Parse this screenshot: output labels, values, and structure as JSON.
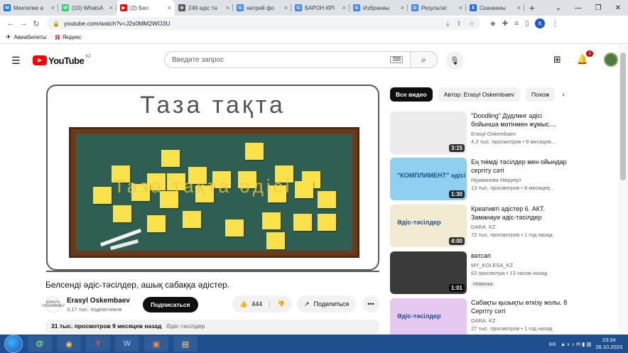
{
  "tabs": [
    {
      "title": "Мектепке а",
      "color": "#1a73e8",
      "glyph": "М"
    },
    {
      "title": "(10) WhatsA",
      "color": "#25d366",
      "glyph": "W"
    },
    {
      "title": "(2) Бел",
      "color": "#ff0000",
      "glyph": "▶",
      "active": true
    },
    {
      "title": "249 әдіс тә",
      "color": "#555555",
      "glyph": "⊕"
    },
    {
      "title": "натрий фо",
      "color": "#4285f4",
      "glyph": "G"
    },
    {
      "title": "БАРОН КРІ",
      "color": "#4285f4",
      "glyph": "G"
    },
    {
      "title": "Избранны",
      "color": "#4285f4",
      "glyph": "G"
    },
    {
      "title": "Результат",
      "color": "#4285f4",
      "glyph": "G"
    },
    {
      "title": "Скачанны",
      "color": "#1a73e8",
      "glyph": "⬇"
    }
  ],
  "url": "youtube.com/watch?v=J2s0MM2WO3U",
  "bookmarks": [
    "Авиабилеты",
    "Яндекс"
  ],
  "yt": {
    "logo": "YouTube",
    "country": "KZ",
    "search_placeholder": "Введите запрос",
    "notif_count": "2"
  },
  "video": {
    "board_title": "Таза тақта",
    "overlay": "Таза тақта әдісі",
    "title": "Белсенді әдіс-тәсілдер, ашық сабаққа әдістер.",
    "channel": "Erasyl Oskembaev",
    "subs": "3,17 тыс. подписчиков",
    "channel_avatar": "ERASYL OSKEMBAEV",
    "subscribe": "Подписаться",
    "likes": "444",
    "share": "Поделиться",
    "desc_meta": "31 тыс. просмотров  9 месяцев назад",
    "desc_tag": "Әдіс-тәсілдер"
  },
  "chips": [
    "Все видео",
    "Автор: Erasyl Oskembaev",
    "Похож"
  ],
  "recs": [
    {
      "title": "\"Doodling\" Дудлинг әдісі бойынша мәтінмен жұмыс....",
      "channel": "Erasyl Oskembaev",
      "views": "4,2 тыс. просмотров • 9 месяцев...",
      "dur": "3:15",
      "bg": "#ececec",
      "thumb_text": ""
    },
    {
      "title": "Ең тиімді тәсілдер мен ойындар сергіту сәті",
      "channel": "Нурманова Меруерт",
      "views": "13 тыс. просмотров • 8 месяцев...",
      "dur": "1:30",
      "bg": "#8fd0f0",
      "thumb_text": "\"КОМПЛИМЕНТ\" әдісі"
    },
    {
      "title": "Креативті әдістер 6. АКТ. Заманауи әдіс-тәсілдер",
      "channel": "DARA. KZ",
      "views": "72 тыс. просмотров • 1 год назад",
      "dur": "4:00",
      "bg": "#f3ead2",
      "thumb_text": "Әдіс-тәсілдер"
    },
    {
      "title": "ватсап",
      "channel": "MY_KOLESA_KZ",
      "views": "63 просмотра • 13 часов назад",
      "dur": "1:01",
      "bg": "#3a3a3a",
      "thumb_text": "",
      "badge": "Новинка"
    },
    {
      "title": "Сабақты қызықты өткізу жолы. 8 Сергіту сәті",
      "channel": "DARA. KZ",
      "views": "27 тыс. просмотров • 1 год назад",
      "dur": "",
      "bg": "#e6c8f0",
      "thumb_text": "Әдіс-тәсілдер"
    }
  ],
  "taskbar": {
    "lang": "KK",
    "time": "23:34",
    "date": "26.10.2023"
  }
}
